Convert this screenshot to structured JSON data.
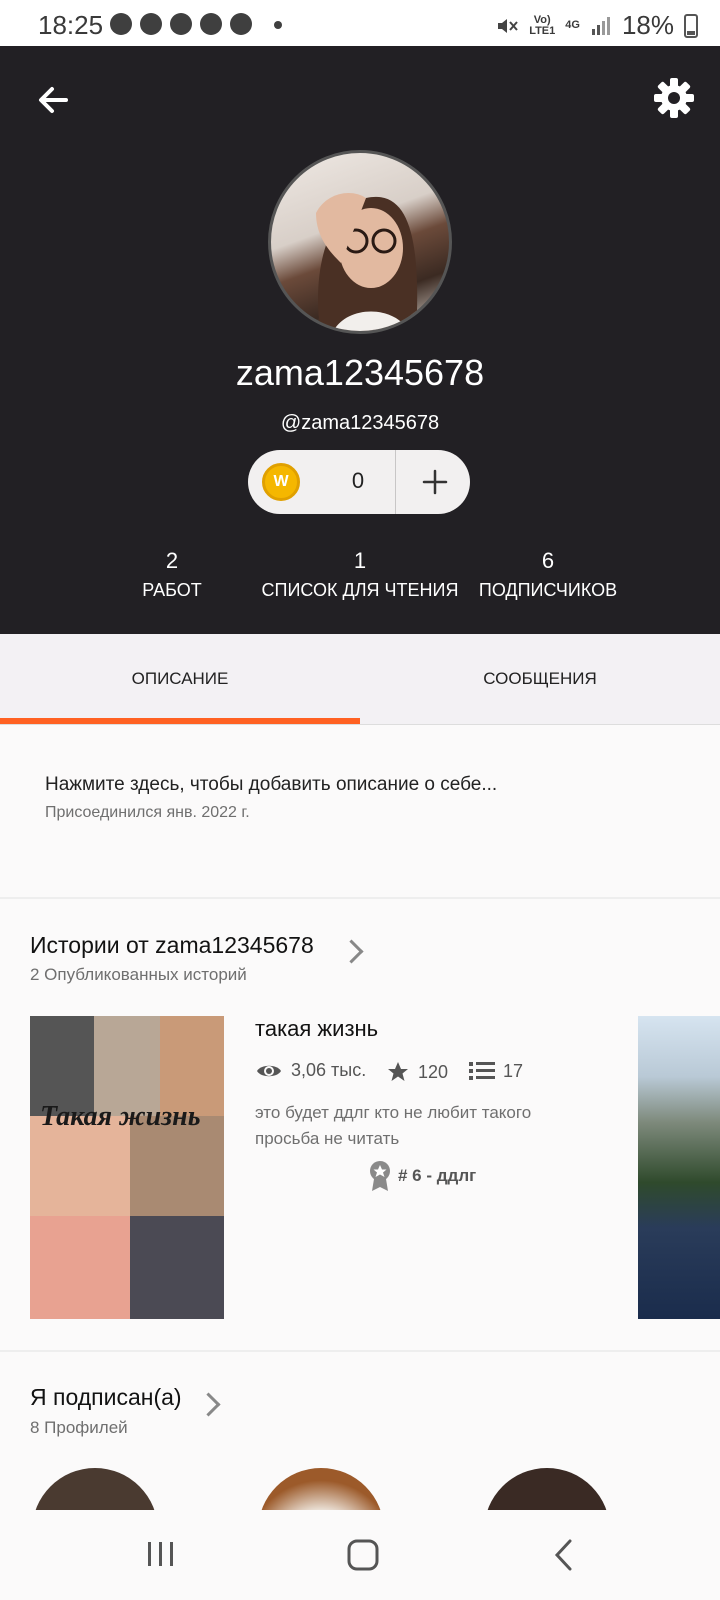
{
  "status_bar": {
    "time": "18:25",
    "battery": "18%",
    "network_top": "Vo)",
    "network_bottom": "LTE1",
    "net4g": "4G"
  },
  "profile": {
    "username": "zama12345678",
    "handle": "@zama12345678",
    "coins": "0",
    "coin_symbol": "W",
    "stats": [
      {
        "value": "2",
        "label": "РАБОТ"
      },
      {
        "value": "1",
        "label": "СПИСОК ДЛЯ ЧТЕНИЯ"
      },
      {
        "value": "6",
        "label": "ПОДПИСЧИКОВ"
      }
    ]
  },
  "tabs": [
    {
      "label": "ОПИСАНИЕ",
      "active": true
    },
    {
      "label": "СООБЩЕНИЯ",
      "active": false
    }
  ],
  "about": {
    "prompt": "Нажмите здесь, чтобы добавить описание о себе...",
    "joined": "Присоединился янв. 2022 г."
  },
  "stories_section": {
    "title": "Истории от zama12345678",
    "subtitle": "2 Опубликованных историй",
    "story": {
      "cover_text": "Такая жизнь",
      "title": "такая жизнь",
      "reads": "3,06 тыс.",
      "votes": "120",
      "parts": "17",
      "description": "это будет ддлг кто не любит такого просьба не читать",
      "rank": "# 6 - ддлг"
    }
  },
  "following_section": {
    "title": "Я подписан(а)",
    "subtitle": "8 Профилей"
  },
  "colors": {
    "accent": "#ff6122",
    "header_bg": "#222024",
    "coin": "#f5b700"
  },
  "icons": [
    "back-arrow-icon",
    "gear-icon",
    "eye-icon",
    "star-icon",
    "list-icon",
    "ribbon-icon",
    "plus-icon"
  ]
}
